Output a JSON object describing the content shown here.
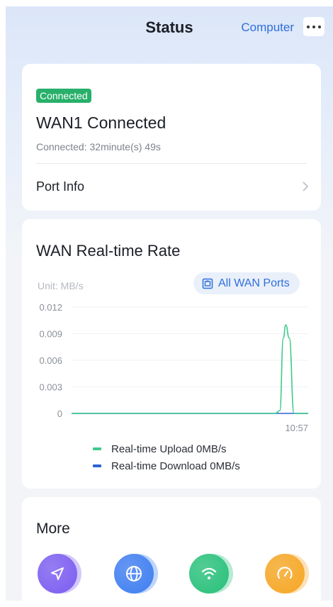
{
  "header": {
    "title": "Status",
    "computer_label": "Computer",
    "more_icon": "more-horizontal-icon"
  },
  "wan": {
    "badge": "Connected",
    "title": "WAN1 Connected",
    "duration": "Connected: 32minute(s) 49s",
    "port_info_label": "Port Info"
  },
  "rate": {
    "title": "WAN Real-time Rate",
    "unit": "Unit: MB/s",
    "ports_button": "All WAN Ports",
    "legend_upload": "Real-time Upload 0MB/s",
    "legend_download": "Real-time Download 0MB/s",
    "upload_color": "#3ec98c",
    "download_color": "#2d63d8"
  },
  "chart_data": {
    "type": "line",
    "x_tick_labels": [
      "10:57"
    ],
    "y_ticks": [
      "0.012",
      "0.009",
      "0.006",
      "0.003",
      "0"
    ],
    "ylim": [
      0,
      0.012
    ],
    "grid": true,
    "series": [
      {
        "name": "Real-time Upload",
        "color": "#3ec98c",
        "points_note": "zero baseline with a single spike near 10:57",
        "x": [
          0,
          0.86,
          0.88,
          0.895,
          0.905,
          0.92,
          0.94,
          1
        ],
        "y": [
          0,
          0,
          0.0003,
          0.0085,
          0.01,
          0.0085,
          0,
          0
        ]
      },
      {
        "name": "Real-time Download",
        "color": "#2d63d8",
        "x": [
          0,
          1
        ],
        "y": [
          0,
          0
        ]
      }
    ]
  },
  "more": {
    "title": "More",
    "icons": [
      {
        "name": "send-icon",
        "color": "#7b5cf0"
      },
      {
        "name": "globe-icon",
        "color": "#3e7df0"
      },
      {
        "name": "wifi-icon",
        "color": "#28c07a"
      },
      {
        "name": "speedometer-icon",
        "color": "#f5a623"
      }
    ]
  }
}
